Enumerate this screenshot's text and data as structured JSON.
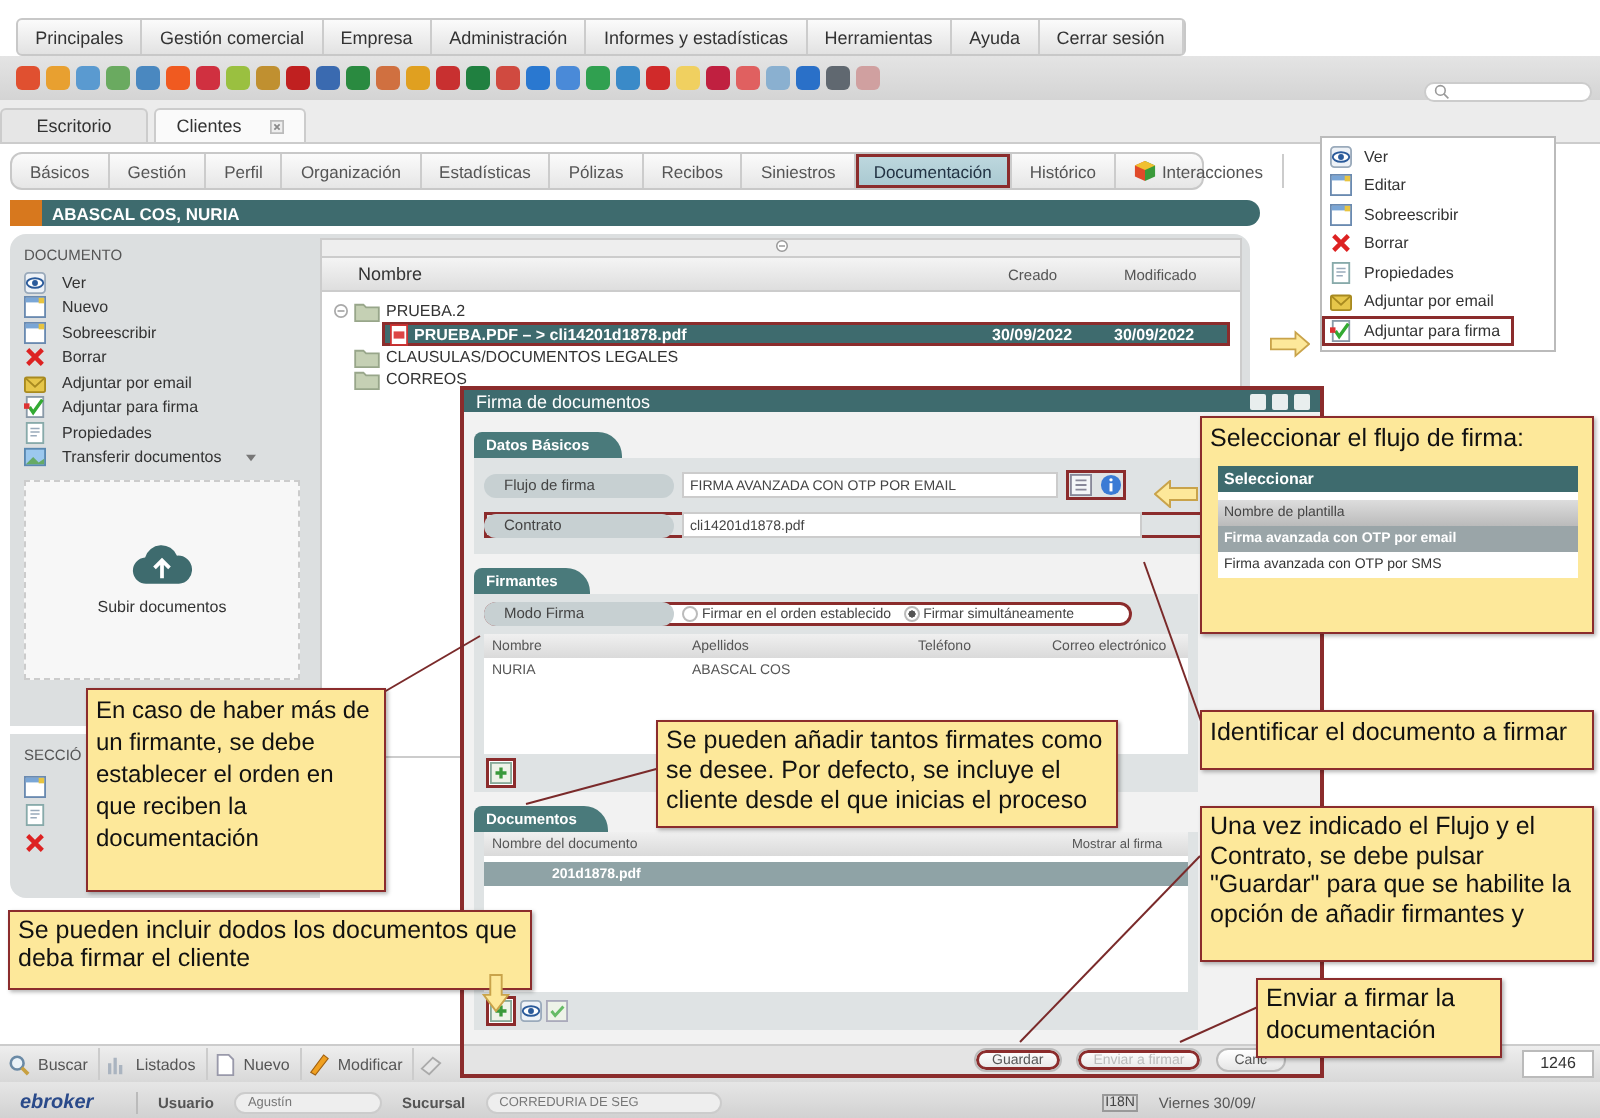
{
  "menu": [
    "Principales",
    "Gestión comercial",
    "Empresa",
    "Administración",
    "Informes y estadísticas",
    "Herramientas",
    "Ayuda",
    "Cerrar sesión"
  ],
  "tabs": [
    {
      "label": "Escritorio",
      "selected": false,
      "closable": false
    },
    {
      "label": "Clientes",
      "selected": true,
      "closable": true
    }
  ],
  "subtabs": [
    {
      "label": "Básicos",
      "selected": false,
      "highlighted": false,
      "icon": false
    },
    {
      "label": "Gestión",
      "selected": false,
      "highlighted": false,
      "icon": false
    },
    {
      "label": "Perfil",
      "selected": false,
      "highlighted": false,
      "icon": false
    },
    {
      "label": "Organización",
      "selected": false,
      "highlighted": false,
      "icon": false
    },
    {
      "label": "Estadísticas",
      "selected": false,
      "highlighted": false,
      "icon": false
    },
    {
      "label": "Pólizas",
      "selected": false,
      "highlighted": false,
      "icon": false
    },
    {
      "label": "Recibos",
      "selected": false,
      "highlighted": false,
      "icon": false
    },
    {
      "label": "Siniestros",
      "selected": false,
      "highlighted": false,
      "icon": false
    },
    {
      "label": "Documentación",
      "selected": true,
      "highlighted": true,
      "icon": false
    },
    {
      "label": "Histórico",
      "selected": false,
      "highlighted": false,
      "icon": false
    },
    {
      "label": "Interacciones",
      "selected": false,
      "highlighted": false,
      "icon": true
    }
  ],
  "client": {
    "name": "ABASCAL COS, NURIA"
  },
  "document_panel": {
    "title": "DOCUMENTO",
    "actions": [
      {
        "label": "Ver",
        "kind": "eye",
        "dropdown": false
      },
      {
        "label": "Nuevo",
        "kind": "doc",
        "dropdown": false
      },
      {
        "label": "Sobreescribir",
        "kind": "doc",
        "dropdown": false
      },
      {
        "label": "Borrar",
        "kind": "delete",
        "dropdown": false
      },
      {
        "label": "Adjuntar por email",
        "kind": "email",
        "dropdown": false
      },
      {
        "label": "Adjuntar para firma",
        "kind": "sign",
        "dropdown": false
      },
      {
        "label": "Propiedades",
        "kind": "props",
        "dropdown": false
      },
      {
        "label": "Transferir documentos",
        "kind": "transfer",
        "dropdown": true
      }
    ],
    "upload": {
      "label": "Subir documentos"
    }
  },
  "section_panel": {
    "title": "SECCIÓ",
    "actions": [
      {
        "kind": "doc"
      },
      {
        "kind": "props"
      },
      {
        "kind": "delete"
      }
    ]
  },
  "files": {
    "columns": [
      "Nombre",
      "Creado",
      "Modificado"
    ],
    "tree": [
      {
        "name": "PRUEBA.2",
        "kind": "folder",
        "selected": false,
        "children": [
          {
            "name": "PRUEBA.PDF – > cli14201d1878.pdf",
            "kind": "pdf",
            "created": "30/09/2022",
            "modified": "30/09/2022",
            "selected": true,
            "highlighted": true
          }
        ]
      },
      {
        "name": "CLAUSULAS/DOCUMENTOS LEGALES",
        "kind": "folder",
        "selected": false
      },
      {
        "name": "CORREOS",
        "kind": "folder",
        "selected": false
      }
    ]
  },
  "context_menu": [
    {
      "label": "Ver",
      "kind": "eye",
      "highlighted": false
    },
    {
      "label": "Editar",
      "kind": "doc",
      "highlighted": false
    },
    {
      "label": "Sobreescribir",
      "kind": "doc",
      "highlighted": false
    },
    {
      "label": "Borrar",
      "kind": "delete",
      "highlighted": false
    },
    {
      "label": "Propiedades",
      "kind": "props",
      "highlighted": false
    },
    {
      "label": "Adjuntar por email",
      "kind": "email",
      "highlighted": false
    },
    {
      "label": "Adjuntar para firma",
      "kind": "sign",
      "highlighted": true
    }
  ],
  "dialog": {
    "title": "Firma de documentos",
    "highlighted": true,
    "basic": {
      "title": "Datos Básicos",
      "fields": [
        {
          "label": "Flujo de firma",
          "value": "FIRMA AVANZADA CON OTP POR EMAIL",
          "kind": "select",
          "highlighted": true
        },
        {
          "label": "Contrato",
          "value": "cli14201d1878.pdf",
          "kind": "text",
          "highlighted": true
        }
      ]
    },
    "signers": {
      "title": "Firmantes",
      "mode_label": "Modo Firma",
      "mode_highlighted": true,
      "options": [
        {
          "label": "Firmar en el orden establecido",
          "selected": false
        },
        {
          "label": "Firmar simultáneamente",
          "selected": true
        }
      ],
      "columns": [
        "Nombre",
        "Apellidos",
        "Teléfono",
        "Correo electrónico"
      ],
      "rows": [
        [
          "NURIA",
          "ABASCAL COS"
        ]
      ],
      "add_highlighted": true
    },
    "documents": {
      "title": "Documentos",
      "columns": [
        "Nombre del documento",
        "Mostrar al firma"
      ],
      "rows": [
        {
          "name": "201d1878.pdf",
          "selected": true
        }
      ],
      "add_highlighted": true
    },
    "buttons": [
      {
        "label": "Guardar",
        "disabled": false,
        "highlighted": true
      },
      {
        "label": "Enviar a firmar",
        "disabled": true,
        "highlighted": true
      },
      {
        "label": "Canc",
        "disabled": false,
        "highlighted": false
      }
    ]
  },
  "callouts": [
    {
      "text": "Seleccionar el flujo de firma:",
      "picker": {
        "title": "Seleccionar",
        "column": "Nombre de plantilla",
        "options": [
          {
            "label": "Firma avanzada con OTP por email",
            "selected": true
          },
          {
            "label": "Firma avanzada con OTP por SMS",
            "selected": false
          }
        ]
      }
    },
    {
      "text": "En caso de haber más de un firmante, se debe establecer el orden en que reciben la documentación"
    },
    {
      "text": "Se pueden añadir tantos firmates como se desee. Por defecto, se incluye el cliente desde el que inicias el proceso"
    },
    {
      "text": "Identificar el documento a firmar"
    },
    {
      "text": "Una vez indicado el Flujo y el Contrato, se debe pulsar \"Guardar\" para que se habilite la opción de añadir firmantes y"
    },
    {
      "text": "Se pueden incluir dodos los documentos que deba firmar el cliente"
    },
    {
      "text": "Enviar a firmar la documentación"
    }
  ],
  "bottom_toolbar": [
    {
      "label": "Buscar",
      "kind": "search"
    },
    {
      "label": "Listados",
      "kind": "chart"
    },
    {
      "label": "Nuevo",
      "kind": "page"
    },
    {
      "label": "Modificar",
      "kind": "pencil"
    }
  ],
  "record_number": "1246",
  "status_bar": {
    "logo": "ebroker",
    "user_label": "Usuario",
    "user": "Agustín",
    "branch_label": "Sucursal",
    "branch": "CORREDURIA DE SEG",
    "locale": "I18N",
    "date": "Viernes 30/09/"
  }
}
